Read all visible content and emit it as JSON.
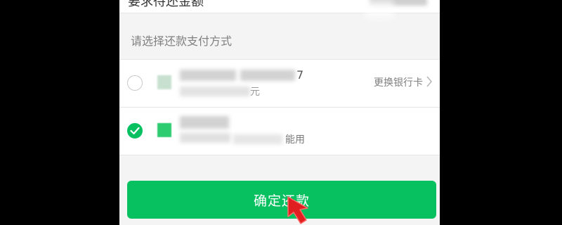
{
  "top_section": {
    "label": "要求待还金额"
  },
  "payment": {
    "section_title": "请选择还款支付方式",
    "options": [
      {
        "row_suffix": "7",
        "sub_suffix": "元",
        "change_card_label": "更换银行卡",
        "selected": false
      },
      {
        "sub_suffix": "能用",
        "selected": true
      }
    ]
  },
  "confirm_button": {
    "label": "确定还款"
  },
  "colors": {
    "accent": "#07c160",
    "background": "#f4f4f4",
    "frame": "#000000"
  },
  "icons": [
    "radio-unchecked-icon",
    "check-icon",
    "bank-logo-icon",
    "chevron-right-icon",
    "red-arrow-cursor-icon"
  ]
}
